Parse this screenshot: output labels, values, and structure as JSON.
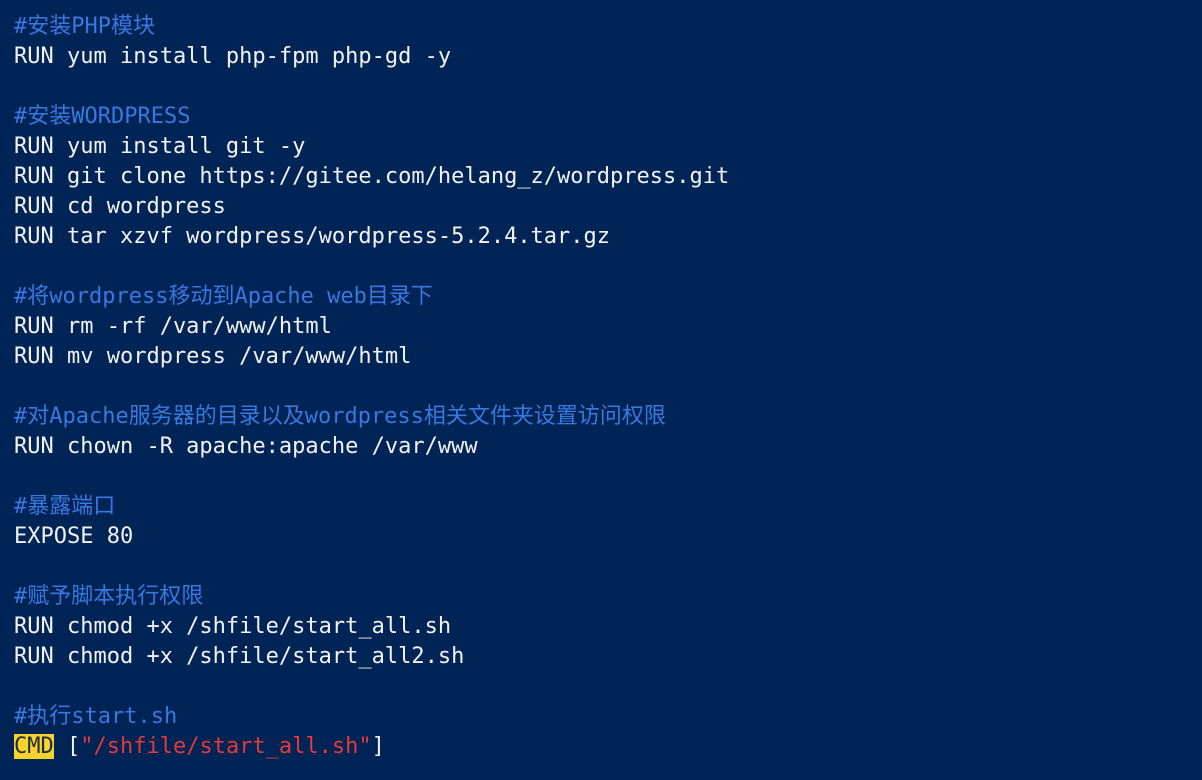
{
  "colors": {
    "background": "#012456",
    "text": "#f2f2f2",
    "comment": "#3a78e0",
    "highlight": "#f6d32d",
    "string": "#e03a3a"
  },
  "lines": {
    "c1": "#安装PHP模块",
    "l1": "RUN yum install php-fpm php-gd -y",
    "c2": "#安装WORDPRESS",
    "l2": "RUN yum install git -y",
    "l3": "RUN git clone https://gitee.com/helang_z/wordpress.git",
    "l4": "RUN cd wordpress",
    "l5": "RUN tar xzvf wordpress/wordpress-5.2.4.tar.gz",
    "c3": "#将wordpress移动到Apache web目录下",
    "l6": "RUN rm -rf /var/www/html",
    "l7": "RUN mv wordpress /var/www/html",
    "c4": "#对Apache服务器的目录以及wordpress相关文件夹设置访问权限",
    "l8": "RUN chown -R apache:apache /var/www",
    "c5": "#暴露端口",
    "l9": "EXPOSE 80",
    "c6": "#赋予脚本执行权限",
    "l10": "RUN chmod +x /shfile/start_all.sh",
    "l11": "RUN chmod +x /shfile/start_all2.sh",
    "c7": "#执行start.sh",
    "cmd_keyword": "CMD",
    "cmd_open": " [",
    "cmd_string": "\"/shfile/start_all.sh\"",
    "cmd_close": "]"
  }
}
